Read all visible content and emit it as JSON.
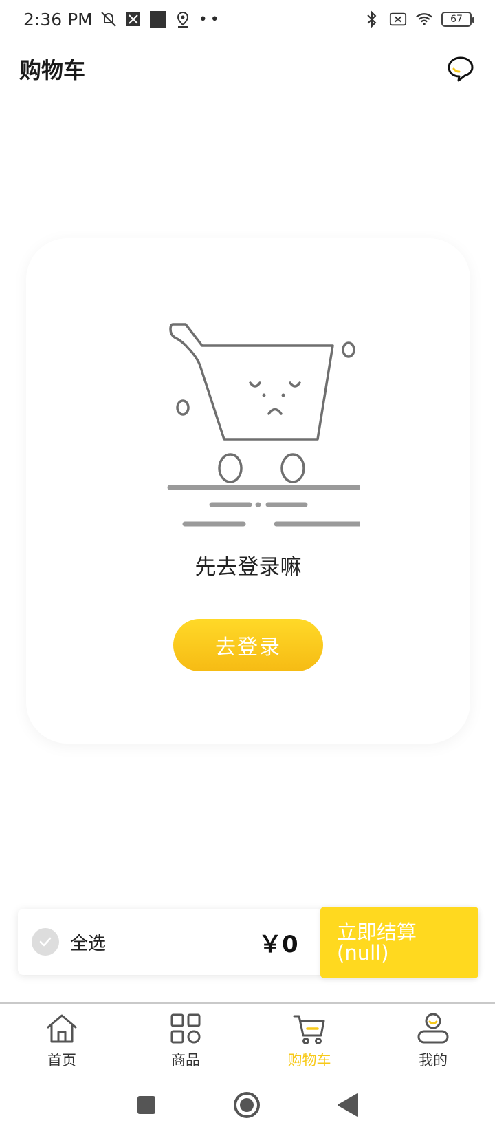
{
  "status_bar": {
    "time": "2:36 PM",
    "battery": "67",
    "icons": [
      "mute-icon",
      "nfc-icon",
      "square-icon",
      "location-icon",
      "dots-icon",
      "bluetooth-icon",
      "no-sim-icon",
      "wifi-icon",
      "battery-icon"
    ]
  },
  "header": {
    "title": "购物车",
    "chat_icon": "chat-bubble-icon"
  },
  "empty_state": {
    "illustration": "sad-cart-icon",
    "message": "先去登录嘛",
    "login_label": "去登录"
  },
  "checkout": {
    "select_all_label": "全选",
    "total": "￥0",
    "checkout_line1": "立即结算",
    "checkout_line2": "(null)"
  },
  "tabs": [
    {
      "label": "首页",
      "icon": "home-icon",
      "active": false
    },
    {
      "label": "商品",
      "icon": "grid-icon",
      "active": false
    },
    {
      "label": "购物车",
      "icon": "cart-icon",
      "active": true
    },
    {
      "label": "我的",
      "icon": "profile-icon",
      "active": false
    }
  ],
  "colors": {
    "accent": "#ffd91f",
    "accent_text": "#f7c919",
    "button_gradient_top": "#ffd928",
    "button_gradient_bottom": "#f6bb14"
  }
}
